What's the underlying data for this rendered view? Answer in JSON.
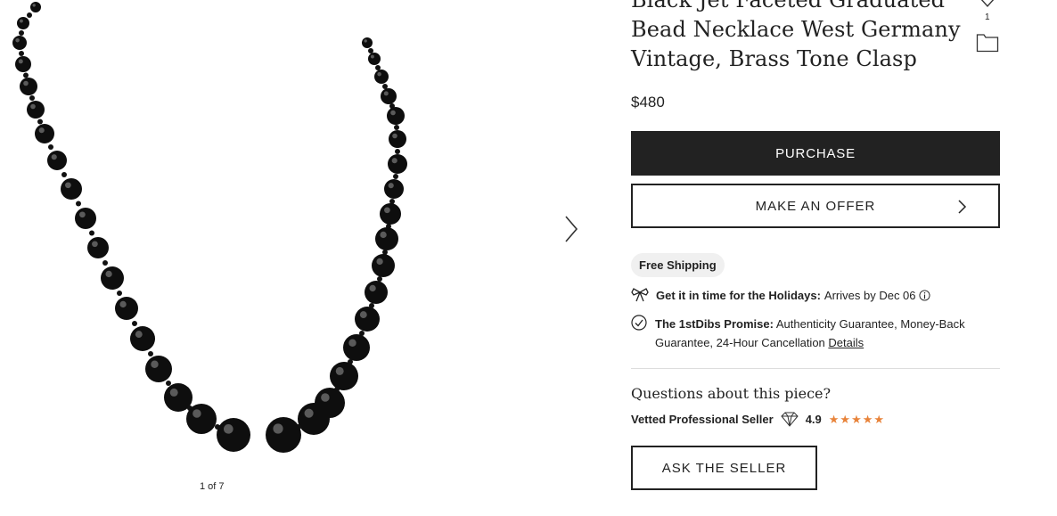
{
  "product": {
    "title_lines": [
      "Black Jet Faceted Graduated",
      "Bead Necklace West Germany",
      "Vintage, Brass Tone Clasp"
    ],
    "price": "$480",
    "favorite_count": "1"
  },
  "gallery": {
    "counter": "1 of 7",
    "next_icon": "chevron-right-icon"
  },
  "actions": {
    "purchase_label": "PURCHASE",
    "offer_label": "MAKE AN OFFER",
    "ask_label": "ASK THE SELLER"
  },
  "shipping": {
    "badge": "Free Shipping",
    "holiday_label": "Get it in time for the Holidays:",
    "holiday_value": "Arrives by Dec 06"
  },
  "promise": {
    "label": "The 1stDibs Promise:",
    "text": "Authenticity Guarantee, Money-Back Guarantee, 24-Hour Cancellation",
    "link": "Details"
  },
  "seller": {
    "questions": "Questions about this piece?",
    "label": "Vetted Professional Seller",
    "rating": "4.9",
    "stars": "★★★★★",
    "star_color": "#e8833a"
  },
  "colors": {
    "primary_button": "#222222",
    "badge_bg": "#f0f0f0"
  }
}
